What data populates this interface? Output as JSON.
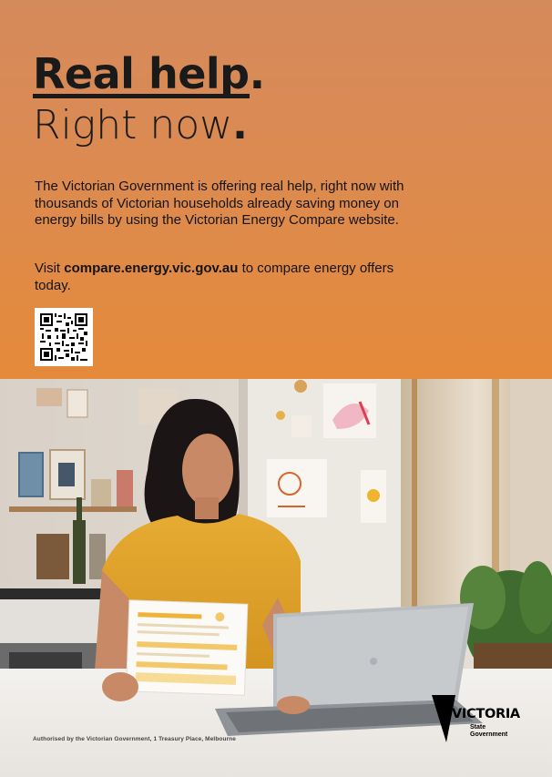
{
  "headline": {
    "line1": "Real help",
    "line1_dot": ".",
    "line2": "Right now",
    "line2_dot": "."
  },
  "body": "The Victorian Government is offering real help, right now with thousands of Victorian households already saving money on energy bills by using the Victorian Energy Compare website.",
  "visit": {
    "prefix": "Visit ",
    "url": "compare.energy.vic.gov.au",
    "suffix": " to compare energy offers today."
  },
  "qr_icon": "qr-code-icon",
  "footer": {
    "authorisation": "Authorised by the Victorian Government, 1 Treasury Place, Melbourne"
  },
  "logo": {
    "word": "VICTORIA",
    "line1": "State",
    "line2": "Government"
  },
  "colors": {
    "panel_top": "#d58a5c",
    "panel_bottom": "#e48a3a",
    "text": "#1a1a1a",
    "shirt": "#e2a52c"
  }
}
